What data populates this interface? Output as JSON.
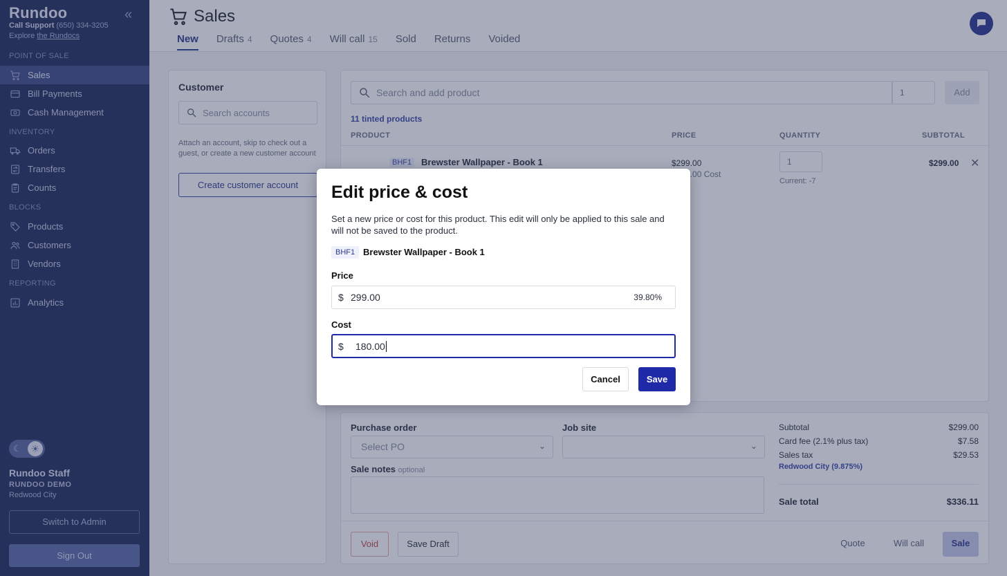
{
  "sidebar": {
    "brand": "Rundoo",
    "support_label": "Call Support",
    "support_phone": "(650) 334-3205",
    "explore_prefix": "Explore",
    "explore_link": "the Rundocs",
    "sections": {
      "pos": "POINT OF SALE",
      "inventory": "INVENTORY",
      "blocks": "BLOCKS",
      "reporting": "REPORTING"
    },
    "items": {
      "sales": "Sales",
      "bill_payments": "Bill Payments",
      "cash_management": "Cash Management",
      "orders": "Orders",
      "transfers": "Transfers",
      "counts": "Counts",
      "products": "Products",
      "customers": "Customers",
      "vendors": "Vendors",
      "analytics": "Analytics"
    },
    "user": {
      "name": "Rundoo Staff",
      "org": "RUNDOO DEMO",
      "city": "Redwood City"
    },
    "switch_admin": "Switch to Admin",
    "sign_out": "Sign Out"
  },
  "header": {
    "title": "Sales",
    "tabs": [
      {
        "label": "New",
        "count": ""
      },
      {
        "label": "Drafts",
        "count": "4"
      },
      {
        "label": "Quotes",
        "count": "4"
      },
      {
        "label": "Will call",
        "count": "15"
      },
      {
        "label": "Sold",
        "count": ""
      },
      {
        "label": "Returns",
        "count": ""
      },
      {
        "label": "Voided",
        "count": ""
      }
    ]
  },
  "customer": {
    "title": "Customer",
    "search_placeholder": "Search accounts",
    "help": "Attach an account, skip to check out a guest, or create a new customer account",
    "create_button": "Create customer account"
  },
  "products": {
    "search_placeholder": "Search and add product",
    "qty": "1",
    "add_button": "Add",
    "tinted": "11 tinted products",
    "columns": {
      "product": "PRODUCT",
      "price": "PRICE",
      "quantity": "QUANTITY",
      "subtotal": "SUBTOTAL"
    },
    "row": {
      "sku": "BHF1",
      "name": "Brewster Wallpaper - Book 1",
      "price": "$299.00",
      "cost": "$180.00 Cost",
      "qty": "1",
      "current": "Current: -7",
      "subtotal": "$299.00"
    }
  },
  "order": {
    "po_label": "Purchase order",
    "po_placeholder": "Select PO",
    "job_label": "Job site",
    "notes_label": "Sale notes",
    "notes_optional": "optional",
    "summary": {
      "subtotal_label": "Subtotal",
      "subtotal": "$299.00",
      "card_fee_label": "Card fee (2.1% plus tax)",
      "card_fee": "$7.58",
      "tax_label": "Sales tax",
      "tax": "$29.53",
      "tax_rate": "Redwood City (9.875%)",
      "total_label": "Sale total",
      "total": "$336.11"
    },
    "buttons": {
      "void": "Void",
      "save_draft": "Save Draft",
      "quote": "Quote",
      "will_call": "Will call",
      "sale": "Sale"
    }
  },
  "modal": {
    "title": "Edit price & cost",
    "description": "Set a new price or cost for this product. This edit will only be applied to this sale and will not be saved to the product.",
    "sku": "BHF1",
    "product_name": "Brewster Wallpaper - Book 1",
    "price_label": "Price",
    "currency": "$",
    "price_value": "299.00",
    "margin": "39.80%",
    "cost_label": "Cost",
    "cost_value": "180.00",
    "cancel": "Cancel",
    "save": "Save"
  },
  "colors": {
    "sidebar_bg": "#1e2a5a",
    "accent": "#1e2aa8",
    "overlay": "rgba(48,58,92,0.42)"
  },
  "icons": [
    "collapse-icon",
    "cart-icon",
    "chat-icon",
    "search-icon",
    "close-icon",
    "chevron-down-icon",
    "moon-icon",
    "sun-icon"
  ]
}
